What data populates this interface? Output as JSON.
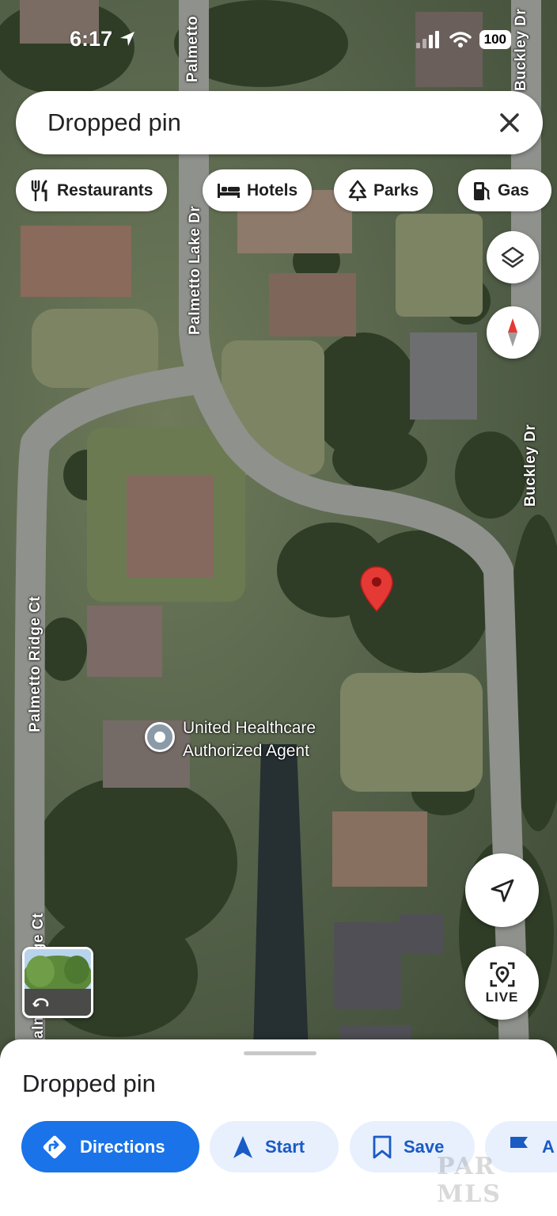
{
  "status_bar": {
    "time": "6:17",
    "battery": "100"
  },
  "search": {
    "value": "Dropped pin"
  },
  "chips": [
    {
      "label": "Restaurants",
      "icon": "fork-knife-icon"
    },
    {
      "label": "Hotels",
      "icon": "bed-icon"
    },
    {
      "label": "Parks",
      "icon": "tree-icon"
    },
    {
      "label": "Gas",
      "icon": "gas-pump-icon"
    }
  ],
  "map": {
    "streets": {
      "palmetto_top": "Palmetto",
      "palmetto_lake": "Palmetto Lake Dr",
      "buckley_top": "Buckley Dr",
      "buckley": "Buckley Dr",
      "palmetto_ridge": "Palmetto Ridge Ct",
      "ridge_bottom": "almetto Ridge Ct"
    },
    "poi": {
      "line1": "United Healthcare",
      "line2": "Authorized Agent"
    },
    "live_label": "LIVE",
    "pin_color": "#e53935"
  },
  "sheet": {
    "title": "Dropped pin",
    "actions": {
      "directions": "Directions",
      "start": "Start",
      "save": "Save",
      "more": "A"
    },
    "watermark": "PAR MLS"
  },
  "colors": {
    "primary_blue": "#1a73e8",
    "chip_bg": "#ffffff",
    "secondary_bg": "#e8f0fe"
  }
}
